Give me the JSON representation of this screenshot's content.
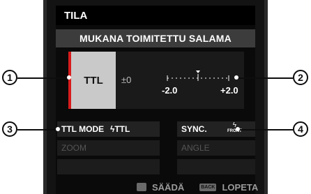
{
  "screen": {
    "title": "TILA",
    "subtitle": "MUKANA TOIMITETTU SALAMA"
  },
  "mode": {
    "selected": "TTL",
    "ev": "±0",
    "scale_min": "-2.0",
    "scale_max": "+2.0"
  },
  "settings": {
    "ttl_mode_label": "TTL MODE",
    "ttl_mode_value": "ϟTTL",
    "sync_label": "SYNC.",
    "sync_value": "FRONT",
    "zoom_label": "ZOOM",
    "angle_label": "ANGLE"
  },
  "footer": {
    "adjust_label": "SÄÄDÄ",
    "back_key": "BACK",
    "exit_label": "LOPETA"
  },
  "callouts": [
    "1",
    "2",
    "3",
    "4"
  ],
  "colors": {
    "accent_red": "#d81b1b",
    "selected_box": "#c9c9c9"
  }
}
